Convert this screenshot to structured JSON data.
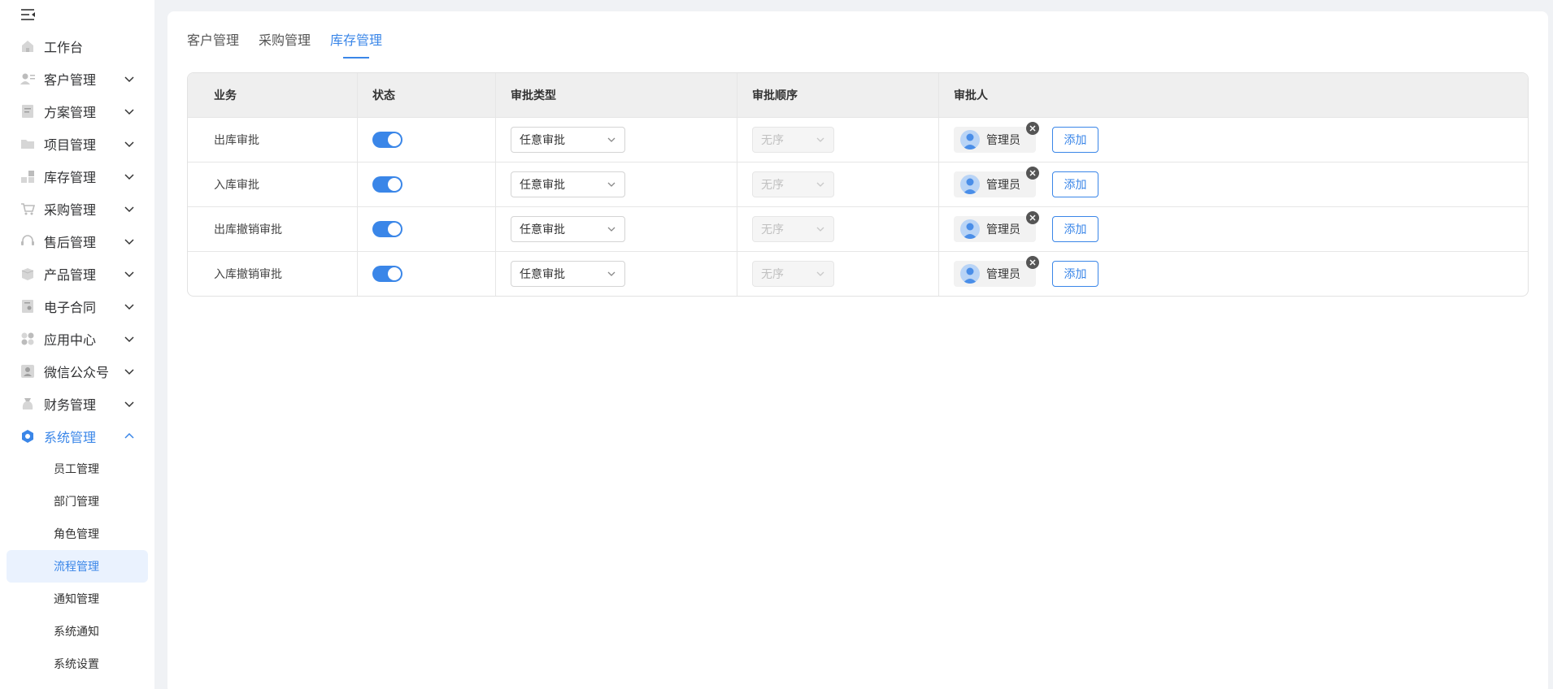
{
  "colors": {
    "accent": "#3a86e8",
    "sidebar_bg": "#ffffff",
    "page_bg": "#f0f2f5"
  },
  "sidebar": {
    "collapse_icon": "menu-fold-icon",
    "items": [
      {
        "label": "工作台",
        "icon": "home-icon",
        "expandable": false
      },
      {
        "label": "客户管理",
        "icon": "customer-icon",
        "expandable": true
      },
      {
        "label": "方案管理",
        "icon": "document-icon",
        "expandable": true
      },
      {
        "label": "项目管理",
        "icon": "folder-icon",
        "expandable": true
      },
      {
        "label": "库存管理",
        "icon": "inventory-icon",
        "expandable": true
      },
      {
        "label": "采购管理",
        "icon": "cart-icon",
        "expandable": true
      },
      {
        "label": "售后管理",
        "icon": "headset-icon",
        "expandable": true
      },
      {
        "label": "产品管理",
        "icon": "box-icon",
        "expandable": true
      },
      {
        "label": "电子合同",
        "icon": "contract-icon",
        "expandable": true
      },
      {
        "label": "应用中心",
        "icon": "apps-icon",
        "expandable": true
      },
      {
        "label": "微信公众号",
        "icon": "wechat-user-icon",
        "expandable": true
      },
      {
        "label": "财务管理",
        "icon": "finance-icon",
        "expandable": true
      },
      {
        "label": "系统管理",
        "icon": "system-icon",
        "expandable": true,
        "expanded": true,
        "active": true
      }
    ],
    "system_submenu": [
      {
        "label": "员工管理"
      },
      {
        "label": "部门管理"
      },
      {
        "label": "角色管理"
      },
      {
        "label": "流程管理",
        "active": true
      },
      {
        "label": "通知管理"
      },
      {
        "label": "系统通知"
      },
      {
        "label": "系统设置"
      }
    ]
  },
  "tabs": [
    {
      "label": "客户管理"
    },
    {
      "label": "采购管理"
    },
    {
      "label": "库存管理",
      "active": true
    }
  ],
  "table": {
    "headers": [
      "业务",
      "状态",
      "审批类型",
      "审批顺序",
      "审批人"
    ],
    "rows": [
      {
        "business": "出库审批",
        "enabled": true,
        "approval_type": "任意审批",
        "approval_order": "无序",
        "approver": "管理员",
        "add_label": "添加"
      },
      {
        "business": "入库审批",
        "enabled": true,
        "approval_type": "任意审批",
        "approval_order": "无序",
        "approver": "管理员",
        "add_label": "添加"
      },
      {
        "business": "出库撤销审批",
        "enabled": true,
        "approval_type": "任意审批",
        "approval_order": "无序",
        "approver": "管理员",
        "add_label": "添加"
      },
      {
        "business": "入库撤销审批",
        "enabled": true,
        "approval_type": "任意审批",
        "approval_order": "无序",
        "approver": "管理员",
        "add_label": "添加"
      }
    ]
  }
}
